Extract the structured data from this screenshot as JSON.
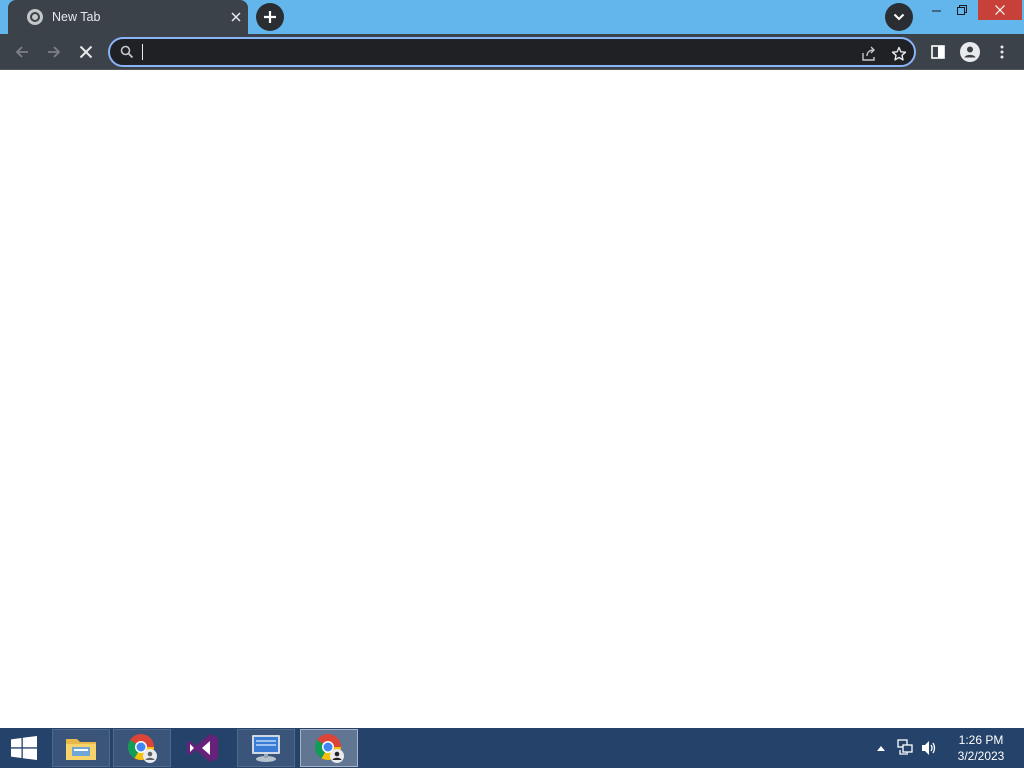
{
  "browser": {
    "tab": {
      "title": "New Tab",
      "favicon": "chrome-newtab-icon",
      "close_icon": "close-icon"
    },
    "new_tab_icon": "plus-icon",
    "tab_search_icon": "chevron-down-icon",
    "window_controls": {
      "minimize_icon": "minimize-icon",
      "restore_icon": "restore-icon",
      "close_icon": "close-icon"
    },
    "toolbar": {
      "back_icon": "arrow-left-icon",
      "forward_icon": "arrow-right-icon",
      "stop_icon": "close-icon",
      "omnibox": {
        "value": "",
        "placeholder": "",
        "search_icon": "search-icon",
        "share_icon": "share-icon",
        "bookmark_icon": "star-icon"
      },
      "side_panel_icon": "side-panel-icon",
      "profile_icon": "person-icon",
      "menu_icon": "kebab-menu-icon"
    },
    "colors": {
      "titlebar": "#62b6ec",
      "toolbar": "#3c4249",
      "omnibox_bg": "#202124",
      "omnibox_focus": "#8ab4f8",
      "close_button": "#c7403a"
    }
  },
  "taskbar": {
    "start_icon": "windows-logo-icon",
    "apps": [
      {
        "name": "File Explorer",
        "icon": "folder-icon",
        "active": false
      },
      {
        "name": "Google Chrome",
        "icon": "chrome-icon",
        "active": false
      },
      {
        "name": "Visual Studio",
        "icon": "visual-studio-icon",
        "active": false
      },
      {
        "name": "Remote Desktop",
        "icon": "remote-desktop-icon",
        "active": false
      },
      {
        "name": "Google Chrome",
        "icon": "chrome-icon",
        "active": true
      }
    ],
    "tray": {
      "show_hidden_icon": "chevron-up-icon",
      "network_icon": "network-icon",
      "volume_icon": "speaker-icon"
    },
    "clock": {
      "time": "1:26 PM",
      "date": "3/2/2023"
    },
    "colors": {
      "background": "#24426a"
    }
  }
}
